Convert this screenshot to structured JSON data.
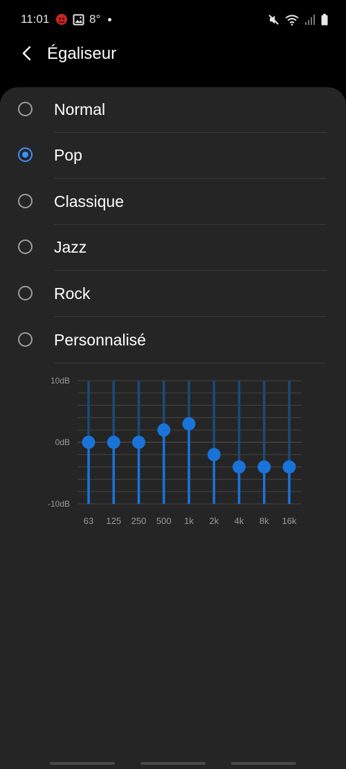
{
  "status_bar": {
    "time": "11:01",
    "temperature": "8°",
    "icons_left": [
      "notification-app-icon",
      "image-icon",
      "dot-icon"
    ],
    "icons_right": [
      "mute-icon",
      "wifi-icon",
      "signal-icon",
      "battery-icon"
    ]
  },
  "header": {
    "title": "Égaliseur",
    "back_icon": "chevron-left-icon"
  },
  "presets": [
    {
      "label": "Normal",
      "selected": false
    },
    {
      "label": "Pop",
      "selected": true
    },
    {
      "label": "Classique",
      "selected": false
    },
    {
      "label": "Jazz",
      "selected": false
    },
    {
      "label": "Rock",
      "selected": false
    },
    {
      "label": "Personnalisé",
      "selected": false
    }
  ],
  "colors": {
    "accent": "#3e91ff",
    "slider": "#1a73d9",
    "panel": "#252525",
    "background": "#000000"
  },
  "chart_data": {
    "type": "line",
    "categories": [
      "63",
      "125",
      "250",
      "500",
      "1k",
      "2k",
      "4k",
      "8k",
      "16k"
    ],
    "values": [
      0,
      0,
      0,
      2,
      3,
      -2,
      -4,
      -4,
      -4
    ],
    "ylim": [
      -10,
      10
    ],
    "y_ticks": [
      "10dB",
      "0dB",
      "-10dB"
    ],
    "grid": true
  }
}
